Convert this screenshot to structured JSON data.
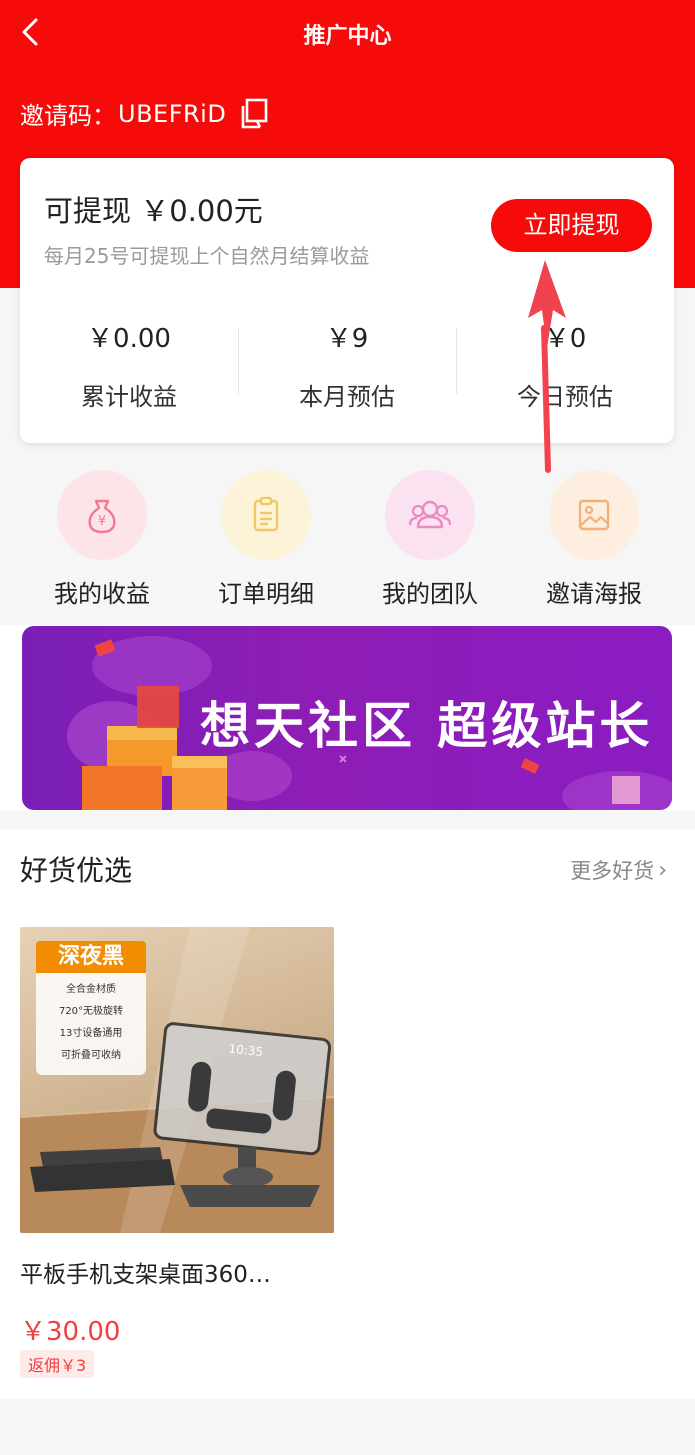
{
  "header": {
    "title": "推广中心",
    "invite_label": "邀请码：",
    "invite_code": "UBEFRiD"
  },
  "card": {
    "withdrawable": "可提现 ￥0.00元",
    "note": "每月25号可提现上个自然月结算收益",
    "withdraw_button": "立即提现",
    "stats": [
      {
        "value": "￥0.00",
        "label": "累计收益"
      },
      {
        "value": "￥9",
        "label": "本月预估"
      },
      {
        "value": "￥0",
        "label": "今日预估"
      }
    ]
  },
  "shortcuts": [
    {
      "label": "我的收益",
      "icon": "money-bag-icon",
      "bg": "#fde4e8",
      "color": "#f07a93"
    },
    {
      "label": "订单明细",
      "icon": "clipboard-icon",
      "bg": "#fdf3d9",
      "color": "#f2c863"
    },
    {
      "label": "我的团队",
      "icon": "team-icon",
      "bg": "#fbe2f0",
      "color": "#e98ac7"
    },
    {
      "label": "邀请海报",
      "icon": "poster-icon",
      "bg": "#fdeee0",
      "color": "#f4b07a"
    }
  ],
  "banner": {
    "text": "想天社区 超级站长"
  },
  "goods": {
    "title": "好货优选",
    "more": "更多好货",
    "products": [
      {
        "tag": "深夜黑",
        "features": [
          "全合金材质",
          "720°无极旋转",
          "13寸设备通用",
          "可折叠可收纳"
        ],
        "screen_time": "10:35",
        "name": "平板手机支架桌面360…",
        "price": "￥30.00",
        "commission": "返佣￥3"
      }
    ]
  },
  "colors": {
    "brand_red": "#f70a0a",
    "price_red": "#f04040"
  }
}
